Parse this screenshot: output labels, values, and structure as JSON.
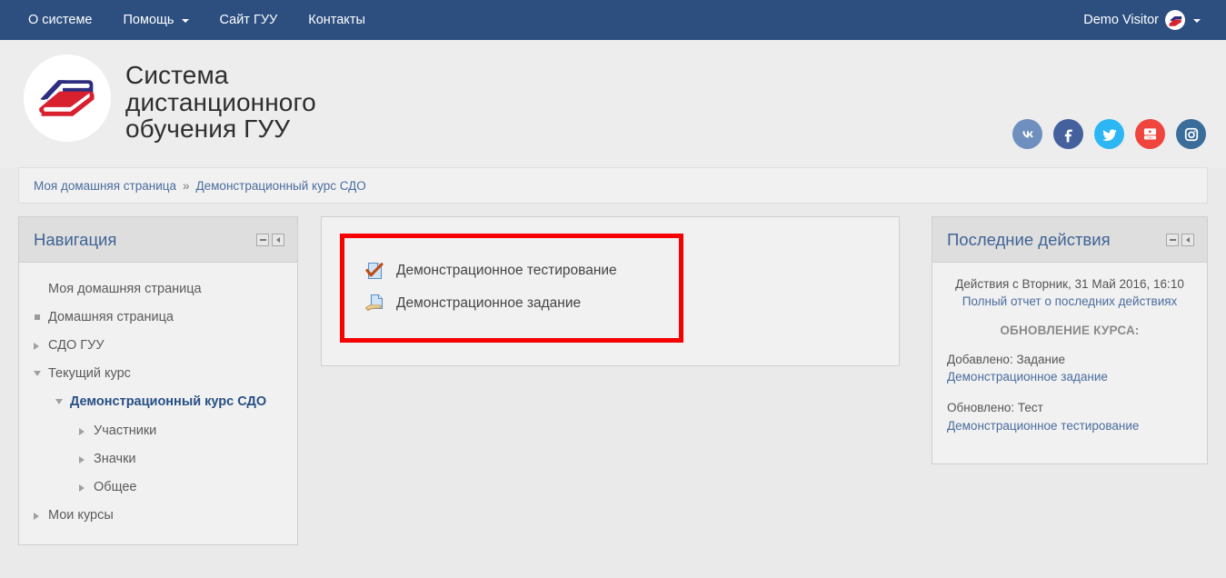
{
  "navbar": {
    "items": [
      {
        "label": "О системе",
        "has_caret": false
      },
      {
        "label": "Помощь",
        "has_caret": true
      },
      {
        "label": "Сайт ГУУ",
        "has_caret": false
      },
      {
        "label": "Контакты",
        "has_caret": false
      }
    ],
    "user": {
      "name": "Demo Visitor",
      "avatar_icon": "books-logo-icon",
      "caret": true
    },
    "background": "#2c4f80"
  },
  "header": {
    "logo_icon": "books-logo-icon",
    "title": "Система\nдистанционного\nобучения ГУУ",
    "socials": [
      {
        "name": "vk",
        "glyph": "VK",
        "color": "#6f8fbe"
      },
      {
        "name": "facebook",
        "glyph": "f",
        "color": "#45619d"
      },
      {
        "name": "twitter",
        "glyph": "t",
        "color": "#2cb6f4"
      },
      {
        "name": "youtube",
        "glyph": "yt",
        "color": "#f0443e"
      },
      {
        "name": "instagram",
        "glyph": "ig",
        "color": "#3a6d99"
      }
    ]
  },
  "breadcrumb": {
    "home": "Моя домашняя страница",
    "separator": "»",
    "current": "Демонстрационный курс СДО"
  },
  "navigation_block": {
    "title": "Навигация",
    "controls": {
      "minimize": "minus-icon",
      "dock": "dock-left-icon"
    },
    "items": [
      {
        "label": "Моя домашняя страница",
        "level": 0,
        "marker": "none",
        "current": false
      },
      {
        "label": "Домашняя страница",
        "level": 1,
        "marker": "square",
        "current": false
      },
      {
        "label": "СДО ГУУ",
        "level": 1,
        "marker": "right",
        "current": false
      },
      {
        "label": "Текущий курс",
        "level": 1,
        "marker": "down",
        "current": false
      },
      {
        "label": "Демонстрационный курс СДО",
        "level": 2,
        "marker": "down",
        "current": true
      },
      {
        "label": "Участники",
        "level": 3,
        "marker": "right",
        "current": false
      },
      {
        "label": "Значки",
        "level": 3,
        "marker": "right",
        "current": false
      },
      {
        "label": "Общее",
        "level": 3,
        "marker": "right",
        "current": false
      },
      {
        "label": "Мои курсы",
        "level": 1,
        "marker": "right",
        "current": false
      }
    ]
  },
  "main": {
    "highlight_color": "#f70000",
    "activities": [
      {
        "label": "Демонстрационное тестирование",
        "icon": "quiz-checkmark-icon"
      },
      {
        "label": "Демонстрационное задание",
        "icon": "assignment-hand-icon"
      }
    ]
  },
  "recent_activity_block": {
    "title": "Последние действия",
    "controls": {
      "minimize": "minus-icon",
      "dock": "dock-left-icon"
    },
    "since_text": "Действия с Вторник, 31 Май 2016, 16:10",
    "full_report_link": "Полный отчет о последних действиях",
    "course_update_heading": "ОБНОВЛЕНИЕ КУРСА:",
    "entries": [
      {
        "type_text": "Добавлено: Задание",
        "link": "Демонстрационное задание"
      },
      {
        "type_text": "Обновлено: Тест",
        "link": "Демонстрационное тестирование"
      }
    ]
  }
}
